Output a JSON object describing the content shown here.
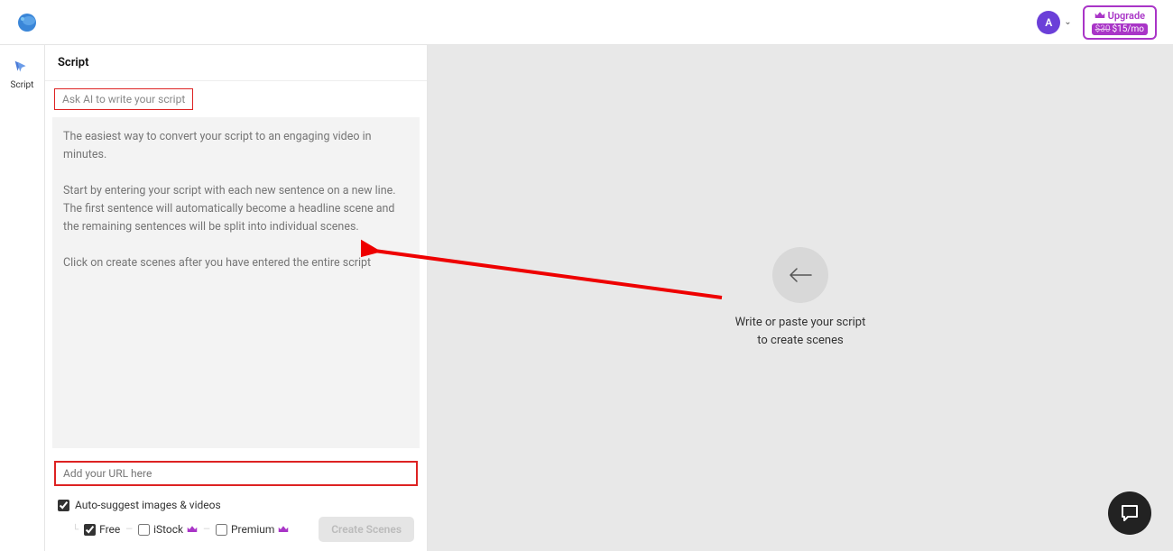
{
  "header": {
    "avatar_letter": "A",
    "upgrade_label": "Upgrade",
    "upgrade_old_price": "$30",
    "upgrade_new_price": "$15/mo"
  },
  "sidebar": {
    "script_label": "Script"
  },
  "panel": {
    "title": "Script",
    "ask_ai_label": "Ask AI to write your script",
    "textarea_placeholder": "The easiest way to convert your script to an engaging video in minutes.\n\nStart by entering your script with each new sentence on a new line. The first sentence will automatically become a headline scene and the remaining sentences will be split into individual scenes.\n\nClick on create scenes after you have entered the entire script",
    "url_placeholder": "Add your URL here",
    "auto_suggest_label": "Auto-suggest images & videos",
    "source_free": "Free",
    "source_istock": "iStock",
    "source_premium": "Premium",
    "create_button": "Create Scenes"
  },
  "preview": {
    "empty_line1": "Write or paste your script",
    "empty_line2": "to create scenes"
  },
  "colors": {
    "accent_purple": "#a935c7",
    "highlight_red": "#d22",
    "avatar_bg": "#6b3fd8"
  }
}
